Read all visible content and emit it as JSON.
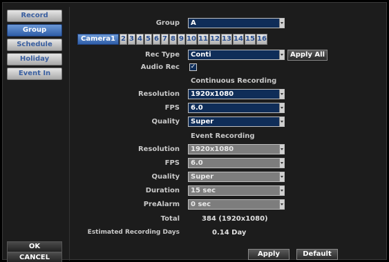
{
  "nav": {
    "items": [
      {
        "label": "Record"
      },
      {
        "label": "Group"
      },
      {
        "label": "Schedule"
      },
      {
        "label": "Holiday"
      },
      {
        "label": "Event In"
      }
    ],
    "active": "Group",
    "ok_label": "OK",
    "cancel_label": "CANCEL"
  },
  "group": {
    "label": "Group",
    "value": "A"
  },
  "tabs": [
    "Camera1",
    "2",
    "3",
    "4",
    "5",
    "6",
    "7",
    "8",
    "9",
    "10",
    "11",
    "12",
    "13",
    "14",
    "15",
    "16"
  ],
  "rec_type": {
    "label": "Rec Type",
    "value": "Conti",
    "apply_all": "Apply All"
  },
  "audio_rec": {
    "label": "Audio Rec",
    "checked": true,
    "check_glyph": "✓"
  },
  "continuous": {
    "title": "Continuous Recording",
    "resolution_label": "Resolution",
    "resolution": "1920x1080",
    "fps_label": "FPS",
    "fps": "6.0",
    "quality_label": "Quality",
    "quality": "Super"
  },
  "event": {
    "title": "Event Recording",
    "resolution_label": "Resolution",
    "resolution": "1920x1080",
    "fps_label": "FPS",
    "fps": "6.0",
    "quality_label": "Quality",
    "quality": "Super",
    "duration_label": "Duration",
    "duration": "15 sec",
    "prealarm_label": "PreAlarm",
    "prealarm": "0 sec"
  },
  "total": {
    "label": "Total",
    "value": "384 (1920x1080)"
  },
  "estimated": {
    "label": "Estimated Recording Days",
    "value": "0.14 Day"
  },
  "footer": {
    "apply_label": "Apply",
    "default_label": "Default"
  },
  "colors": {
    "active_tab": "#2f5ea8",
    "field_bg": "#0f2d58",
    "disabled_field": "#7d7d7d"
  }
}
